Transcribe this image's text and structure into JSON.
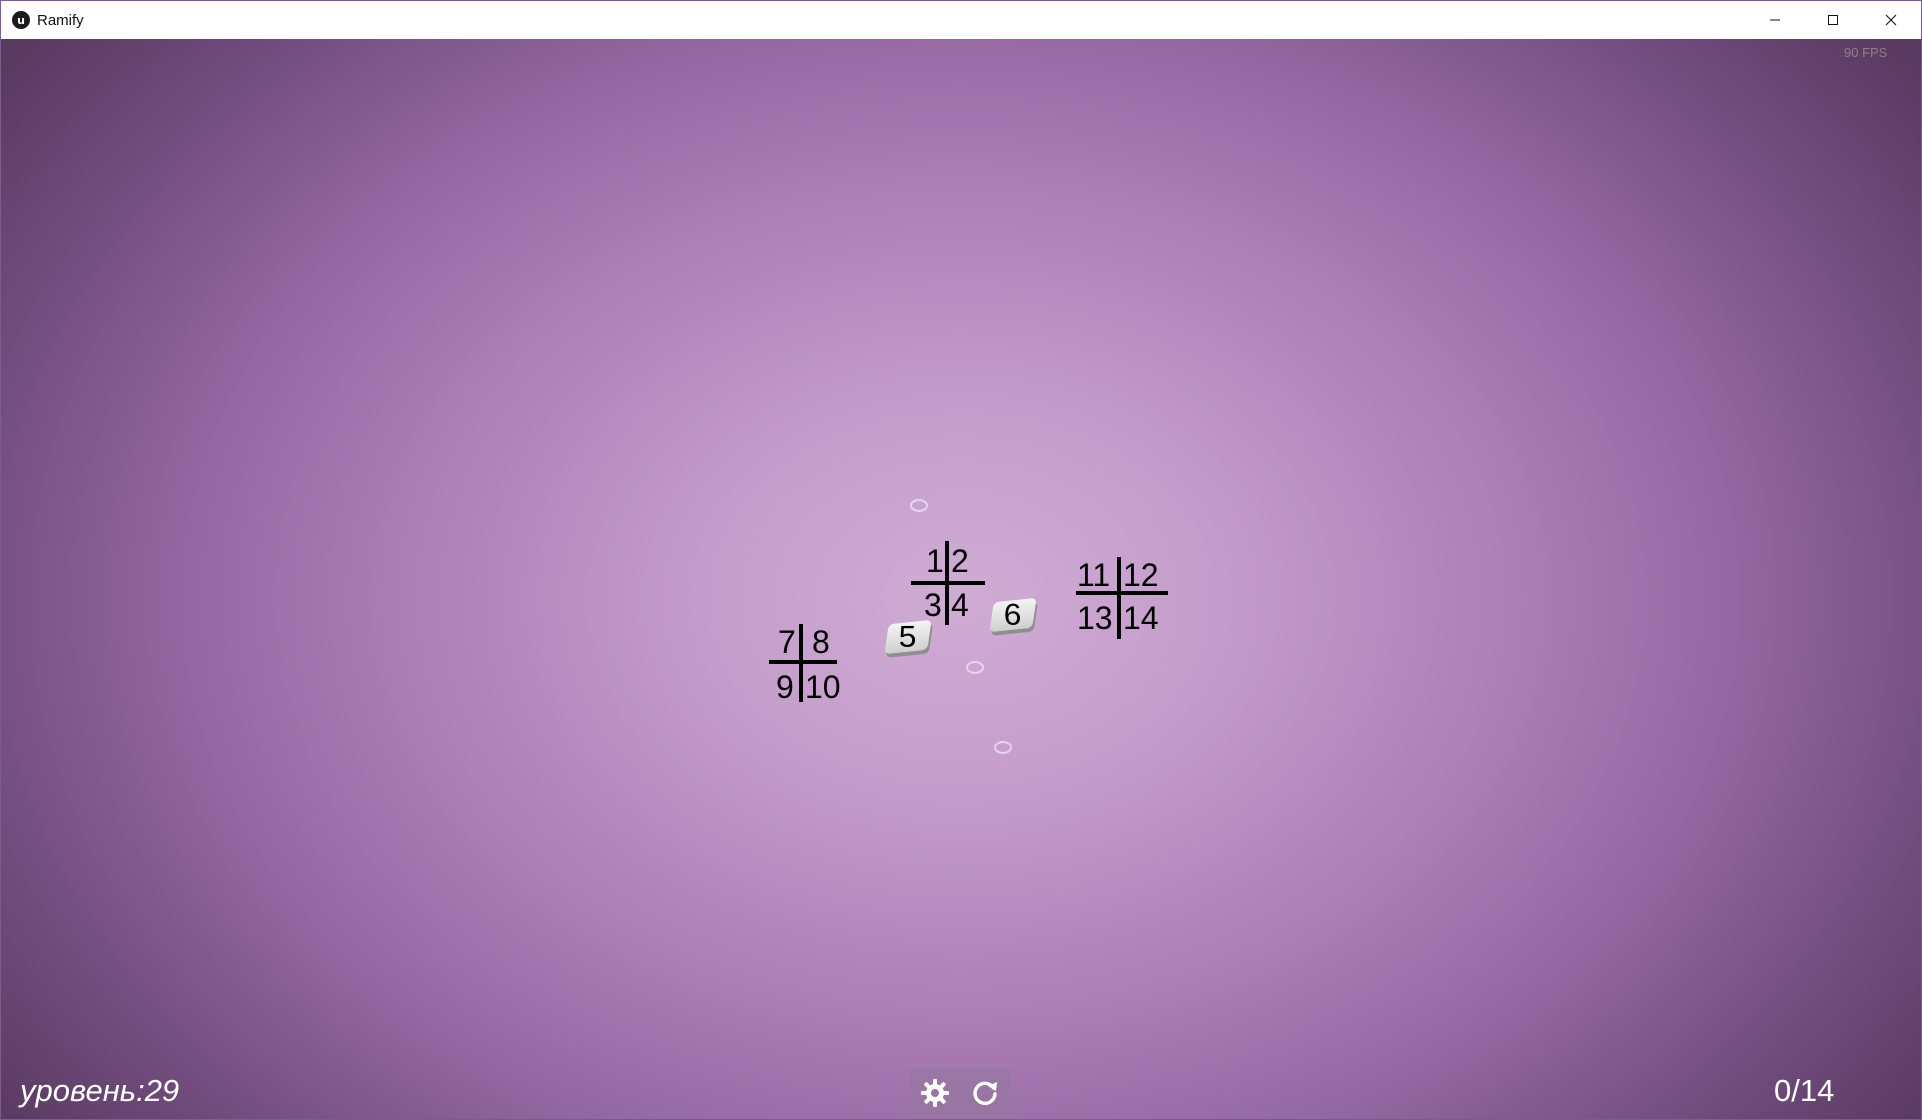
{
  "window": {
    "title": "Ramify",
    "logo_glyph": "u",
    "icons": [
      "minimize-icon",
      "maximize-icon",
      "close-icon"
    ]
  },
  "hud": {
    "fps": "90 FPS",
    "level_label": "уровень:29",
    "score": "0/14"
  },
  "board": {
    "cross_a": {
      "tl": "1",
      "tr": "2",
      "bl": "3",
      "br": "4"
    },
    "tile_5": "5",
    "tile_6": "6",
    "cross_b": {
      "tl": "7",
      "tr": "8",
      "bl": "9",
      "br": "10"
    },
    "cross_c": {
      "tl": "11",
      "tr": "12",
      "bl": "13",
      "br": "14"
    }
  },
  "controls": {
    "settings_icon": "gear-icon",
    "restart_icon": "restart-icon"
  },
  "colors": {
    "bg_center": "#d0acd4",
    "bg_edge": "#58395f",
    "text_hud": "#ffffff"
  }
}
